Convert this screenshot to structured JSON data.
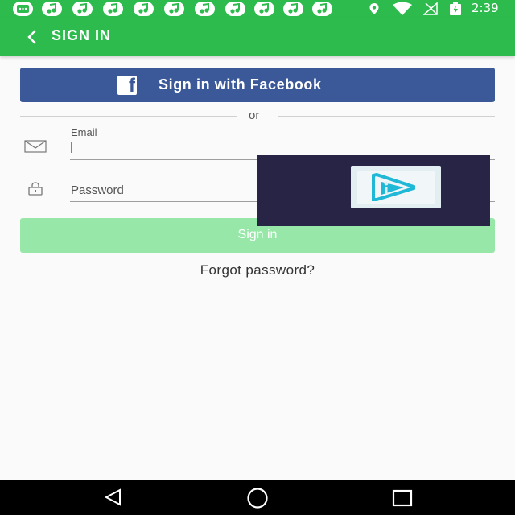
{
  "status_bar": {
    "time": "2:39",
    "notification_icons": [
      "message-icon",
      "music-note-icon",
      "music-note-icon",
      "music-note-icon",
      "music-note-icon",
      "music-note-icon",
      "music-note-icon",
      "music-note-icon",
      "music-note-icon",
      "music-note-icon",
      "music-note-icon"
    ],
    "system_icons": [
      "location-icon",
      "wifi-icon",
      "no-signal-icon",
      "battery-charging-icon"
    ]
  },
  "app_bar": {
    "title": "SIGN IN",
    "back_icon": "chevron-left-icon",
    "color": "#2dbb4e"
  },
  "facebook_button": {
    "label": "Sign in with Facebook",
    "icon": "facebook-icon",
    "color": "#3b5998"
  },
  "divider": {
    "label": "or"
  },
  "email_field": {
    "label": "Email",
    "value": "",
    "icon": "mail-icon"
  },
  "password_field": {
    "placeholder": "Password",
    "icon": "lock-icon"
  },
  "signin_button": {
    "label": "Sign in",
    "color": "#97e8a8",
    "state": "disabled"
  },
  "forgot_link": {
    "label": "Forgot password?"
  },
  "overlay": {
    "icon": "video-play-logo-icon"
  },
  "nav_bar": {
    "buttons": [
      "back-triangle-icon",
      "home-circle-icon",
      "recents-square-icon"
    ]
  }
}
